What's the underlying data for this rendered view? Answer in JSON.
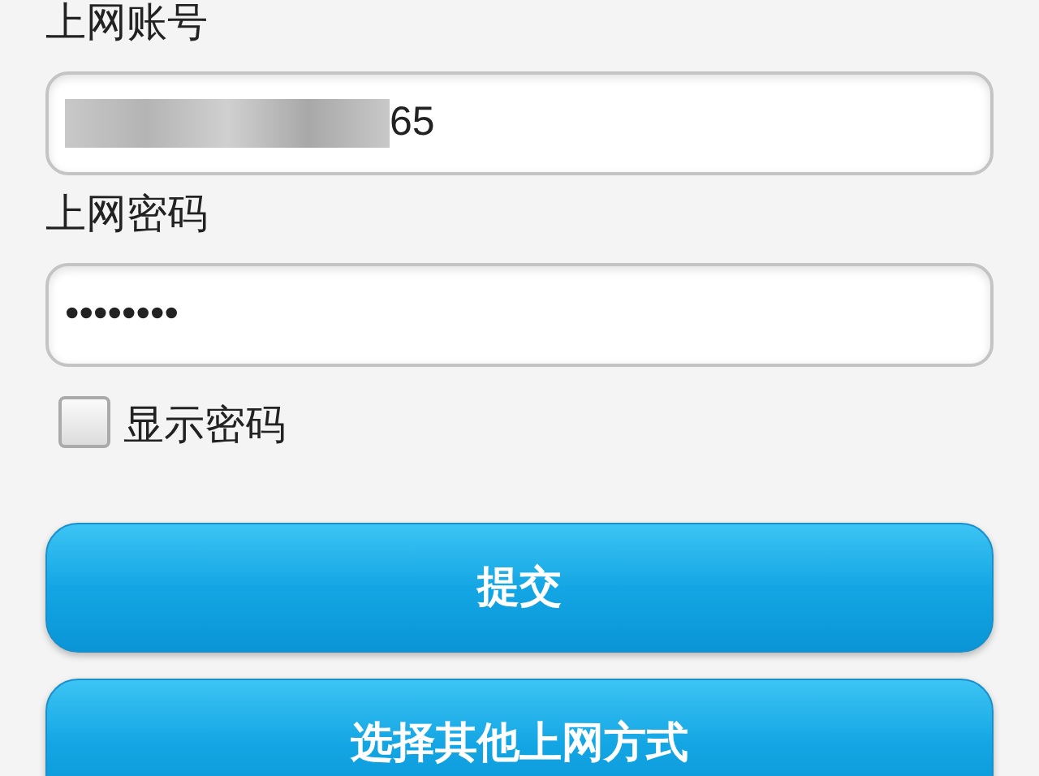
{
  "fields": [
    {
      "label": "上网账号",
      "value": "65",
      "redacted": true
    },
    {
      "label": "上网密码",
      "value": "••••••••",
      "redacted": false
    }
  ],
  "show_password": {
    "label": "显示密码",
    "checked": false
  },
  "buttons": [
    {
      "label": "提交"
    },
    {
      "label": "选择其他上网方式"
    }
  ]
}
